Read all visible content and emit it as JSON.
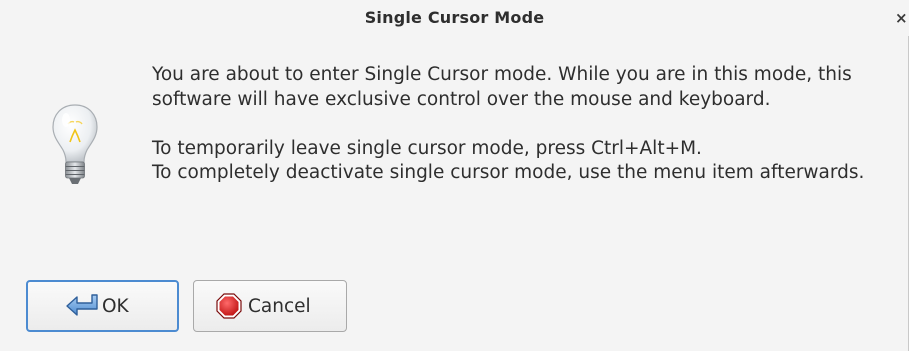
{
  "dialog": {
    "title": "Single Cursor Mode",
    "close_label": "×",
    "icon": "lightbulb-icon",
    "message_paragraph_1": "You are about to enter Single Cursor mode. While you are in this mode, this software will have exclusive control over the mouse and keyboard.",
    "message_paragraph_2_line_1": "To temporarily leave single cursor mode, press Ctrl+Alt+M.",
    "message_paragraph_2_line_2": "To completely deactivate single cursor mode, use the menu item afterwards."
  },
  "buttons": {
    "ok": {
      "label": "OK",
      "icon": "return-arrow-icon"
    },
    "cancel": {
      "label": "Cancel",
      "icon": "stop-icon"
    }
  },
  "colors": {
    "dialog_background": "#f4f4f4",
    "text": "#2e2e2e",
    "focus_border": "#4c8bd1",
    "stop_red": "#d01818"
  }
}
